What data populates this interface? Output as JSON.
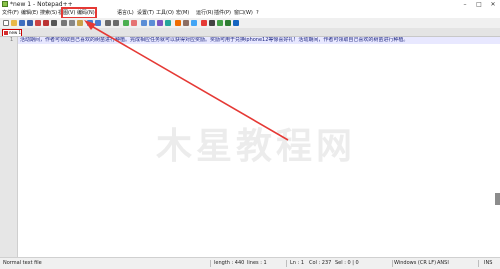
{
  "window": {
    "title": "*new 1 - Notepad++",
    "minimize": "–",
    "maximize": "□",
    "close": "✕"
  },
  "menu": {
    "items": [
      "文件(F)",
      "编辑(E)",
      "搜索(S)",
      "视图(V)",
      "编码(N)",
      "语言(L)",
      "设置(T)",
      "工具(O)",
      "宏(M)",
      "运行(R)",
      "插件(P)",
      "窗口(W)",
      "?"
    ],
    "highlighted": "编码(N)",
    "highlight_color": "#e53935"
  },
  "tab": {
    "label": "new 1"
  },
  "editor": {
    "line_number": "1",
    "line_text": "活动期间，作者可领取自己喜欢的树苗进行种植。完成相应任务就可以获得对应奖励。奖励可用于兑换iphone12等惊喜好礼！活动期间，作者可领取自己喜欢的树苗进行种植。"
  },
  "watermark": "木星教程网",
  "status": {
    "mode": "Normal text file",
    "length": "length : 440",
    "lines": "lines : 1",
    "ln": "Ln : 1",
    "col": "Col : 237",
    "sel": "Sel : 0 | 0",
    "eol": "Windows (CR LF)",
    "encoding": "ANSI",
    "ins": "INS"
  }
}
